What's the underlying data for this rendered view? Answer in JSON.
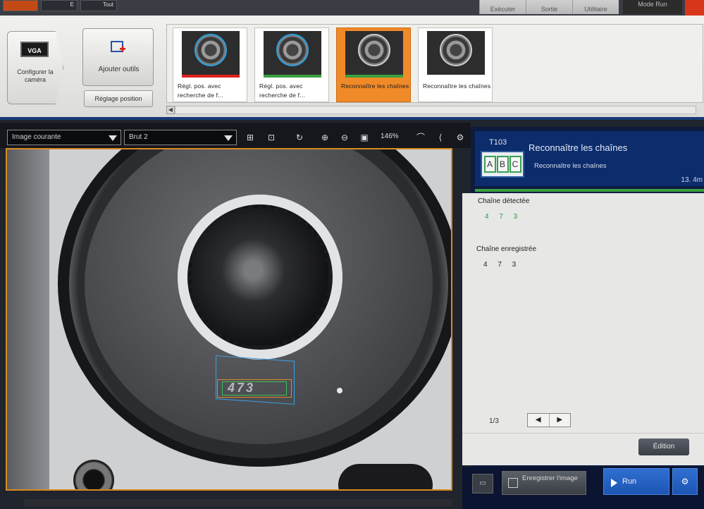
{
  "topbar": {
    "tabs": [
      "",
      "E",
      "Tout"
    ],
    "menu": [
      "Exécuter",
      "Sortie",
      "Utilitaire"
    ],
    "mode_label": "Mode Run"
  },
  "toolbar": {
    "camera_badge": "VGA",
    "camera_button": "Configurer la caméra",
    "add_tools": "Ajouter outils",
    "position_setting": "Réglage position",
    "tools": [
      {
        "caption": "Régl. pos. avec recherche de f...",
        "status_color": "#e02020"
      },
      {
        "caption": "Régl. pos. avec recherche de f...",
        "status_color": "#3aa040"
      },
      {
        "caption": "Reconnaître les chaînes",
        "status_color": "#3aa040"
      },
      {
        "caption": "Reconnaître les chaînes",
        "status_color": ""
      }
    ]
  },
  "image_bar": {
    "image_select": "Image courante",
    "mode_select": "Brut 2",
    "zoom": "146%"
  },
  "viewer": {
    "detected_code": "473"
  },
  "panel": {
    "tool_id": "T103",
    "icon_letters": [
      "A",
      "B",
      "C"
    ],
    "title": "Reconnaître les chaînes",
    "subtitle": "Reconnaître les chaînes",
    "time": "13. 4m",
    "detected_label": "Chaîne détectée",
    "detected_value": "4 7 3",
    "registered_label": "Chaîne enregistrée",
    "registered_value": "4 7 3",
    "page": "1/3",
    "prev": "◀",
    "next": "▶",
    "edit": "Édition"
  },
  "bottom": {
    "save_image": "Enregistrer l'image",
    "run": "Run"
  },
  "colors": {
    "accent_orange": "#f08a28",
    "panel_blue": "#0c2c6c",
    "ok_green": "#3aa040"
  }
}
